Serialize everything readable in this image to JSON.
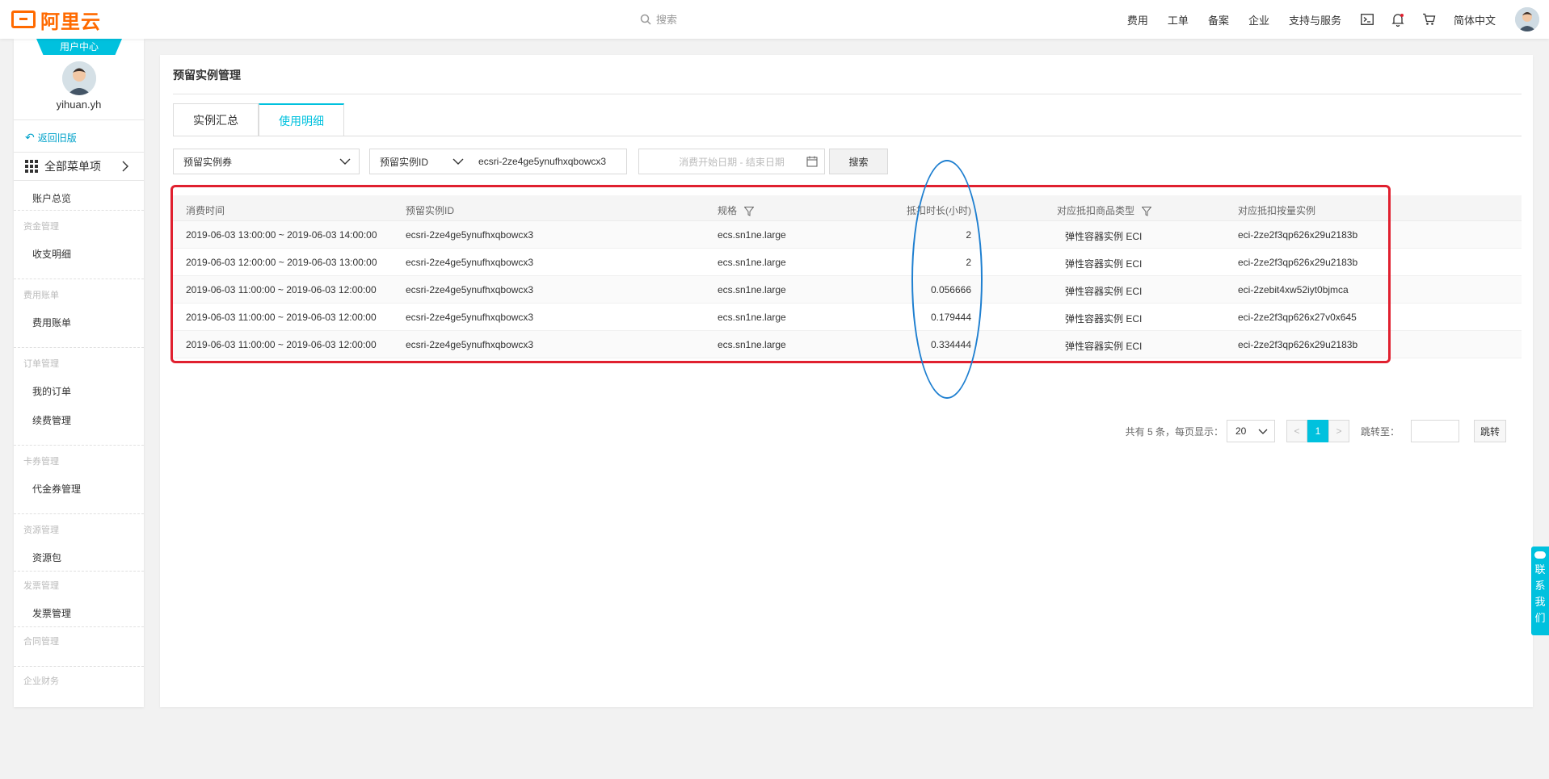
{
  "header": {
    "logo_text": "阿里云",
    "search_placeholder": "搜索",
    "nav": [
      "费用",
      "工单",
      "备案",
      "企业",
      "支持与服务"
    ],
    "language": "简体中文"
  },
  "sidebar": {
    "badge": "用户中心",
    "username": "yihuan.yh",
    "back_link": "返回旧版",
    "all_menu": "全部菜单项",
    "overview": "账户总览",
    "groups": {
      "funds": "资金管理",
      "funds_item": "收支明细",
      "bills": "费用账单",
      "bills_item": "费用账单",
      "orders": "订单管理",
      "orders_item1": "我的订单",
      "orders_item2": "续费管理",
      "vouchers": "卡券管理",
      "vouchers_item": "代金券管理",
      "resources": "资源管理",
      "resources_item": "资源包",
      "invoices": "发票管理",
      "invoices_item": "发票管理",
      "contracts": "合同管理",
      "finance": "企业财务"
    }
  },
  "main": {
    "title": "预留实例管理",
    "tabs": [
      "实例汇总",
      "使用明细"
    ],
    "filters": {
      "type_select": "预留实例券",
      "id_select": "预留实例ID",
      "id_value": "ecsri-2ze4ge5ynufhxqbowcx3",
      "date_placeholder": "消费开始日期 - 结束日期",
      "search_btn": "搜索"
    },
    "table": {
      "headers": [
        "消费时间",
        "预留实例ID",
        "规格",
        "抵扣时长(小时)",
        "对应抵扣商品类型",
        "对应抵扣按量实例"
      ],
      "rows": [
        [
          "2019-06-03 13:00:00 ~ 2019-06-03 14:00:00",
          "ecsri-2ze4ge5ynufhxqbowcx3",
          "ecs.sn1ne.large",
          "2",
          "弹性容器实例 ECI",
          "eci-2ze2f3qp626x29u2183b"
        ],
        [
          "2019-06-03 12:00:00 ~ 2019-06-03 13:00:00",
          "ecsri-2ze4ge5ynufhxqbowcx3",
          "ecs.sn1ne.large",
          "2",
          "弹性容器实例 ECI",
          "eci-2ze2f3qp626x29u2183b"
        ],
        [
          "2019-06-03 11:00:00 ~ 2019-06-03 12:00:00",
          "ecsri-2ze4ge5ynufhxqbowcx3",
          "ecs.sn1ne.large",
          "0.056666",
          "弹性容器实例 ECI",
          "eci-2zebit4xw52iyt0bjmca"
        ],
        [
          "2019-06-03 11:00:00 ~ 2019-06-03 12:00:00",
          "ecsri-2ze4ge5ynufhxqbowcx3",
          "ecs.sn1ne.large",
          "0.179444",
          "弹性容器实例 ECI",
          "eci-2ze2f3qp626x27v0x645"
        ],
        [
          "2019-06-03 11:00:00 ~ 2019-06-03 12:00:00",
          "ecsri-2ze4ge5ynufhxqbowcx3",
          "ecs.sn1ne.large",
          "0.334444",
          "弹性容器实例 ECI",
          "eci-2ze2f3qp626x29u2183b"
        ]
      ]
    },
    "pager": {
      "summary": "共有 5 条，每页显示：",
      "page_size": "20",
      "prev": "<",
      "current": "1",
      "next": ">",
      "jump_label": "跳转至：",
      "jump_btn": "跳转"
    }
  },
  "contact": "联系我们",
  "colors": {
    "accent": "#00c1de",
    "brand": "#ff6a00",
    "annotation_red": "#e0202f",
    "annotation_blue": "#1e7fd0"
  }
}
